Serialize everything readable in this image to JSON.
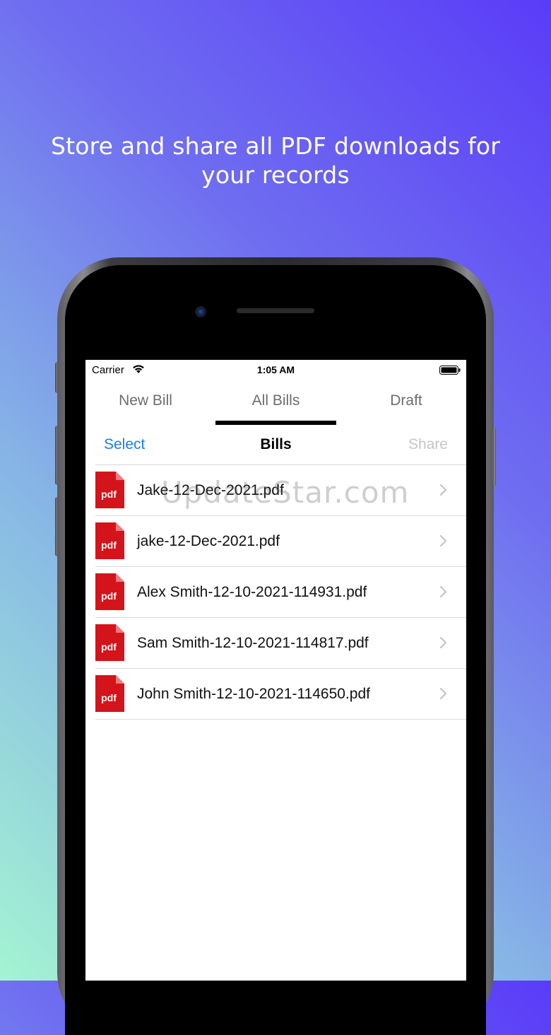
{
  "headline": {
    "line1": "Store and share all PDF downloads for",
    "line2": "your records"
  },
  "status_bar": {
    "carrier": "Carrier",
    "time": "1:05 AM",
    "icons": [
      "wifi-icon",
      "battery-icon"
    ]
  },
  "tabs": [
    {
      "label": "New Bill",
      "selected": false
    },
    {
      "label": "All Bills",
      "selected": true
    },
    {
      "label": "Draft",
      "selected": false
    }
  ],
  "nav": {
    "select_label": "Select",
    "title": "Bills",
    "share_label": "Share"
  },
  "files": [
    {
      "name": "Jake-12-Dec-2021.pdf",
      "icon_text": "pdf"
    },
    {
      "name": "jake-12-Dec-2021.pdf",
      "icon_text": "pdf"
    },
    {
      "name": "Alex Smith-12-10-2021-114931.pdf",
      "icon_text": "pdf"
    },
    {
      "name": "Sam Smith-12-10-2021-114817.pdf",
      "icon_text": "pdf"
    },
    {
      "name": "John Smith-12-10-2021-114650.pdf",
      "icon_text": "pdf"
    }
  ],
  "watermark": "UpdateStar.com",
  "colors": {
    "accent_blue": "#1a7ff0",
    "pdf_red": "#d4141b",
    "disabled_gray": "#c6c6c9"
  }
}
